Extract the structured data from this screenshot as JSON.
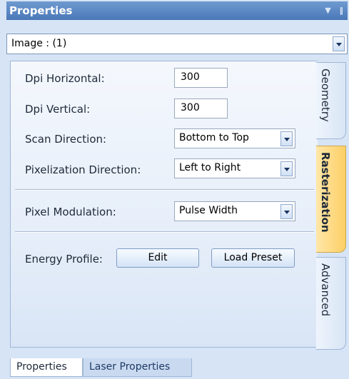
{
  "window": {
    "title": "Properties"
  },
  "selector": {
    "value": "Image : (1)"
  },
  "fields": {
    "dpi_horizontal": {
      "label": "Dpi Horizontal:",
      "value": "300"
    },
    "dpi_vertical": {
      "label": "Dpi Vertical:",
      "value": "300"
    },
    "scan_direction": {
      "label": "Scan Direction:",
      "value": "Bottom to Top"
    },
    "pixelization_direction": {
      "label": "Pixelization Direction:",
      "value": "Left to Right"
    },
    "pixel_modulation": {
      "label": "Pixel Modulation:",
      "value": "Pulse Width"
    },
    "energy_profile": {
      "label": "Energy Profile:",
      "edit_label": "Edit",
      "load_label": "Load Preset"
    }
  },
  "side_tabs": [
    {
      "label": "Geometry",
      "active": false
    },
    {
      "label": "Rasterization",
      "active": true
    },
    {
      "label": "Advanced",
      "active": false
    }
  ],
  "bottom_tabs": [
    {
      "label": "Properties",
      "active": true
    },
    {
      "label": "Laser Properties",
      "active": false
    }
  ],
  "icons": {
    "title_pin": "pin-icon",
    "title_menu": "dropdown-icon"
  },
  "colors": {
    "titlebar": "#4a78b8",
    "active_tab": "#fccf65",
    "panel_bg": "#d6e4f5"
  }
}
